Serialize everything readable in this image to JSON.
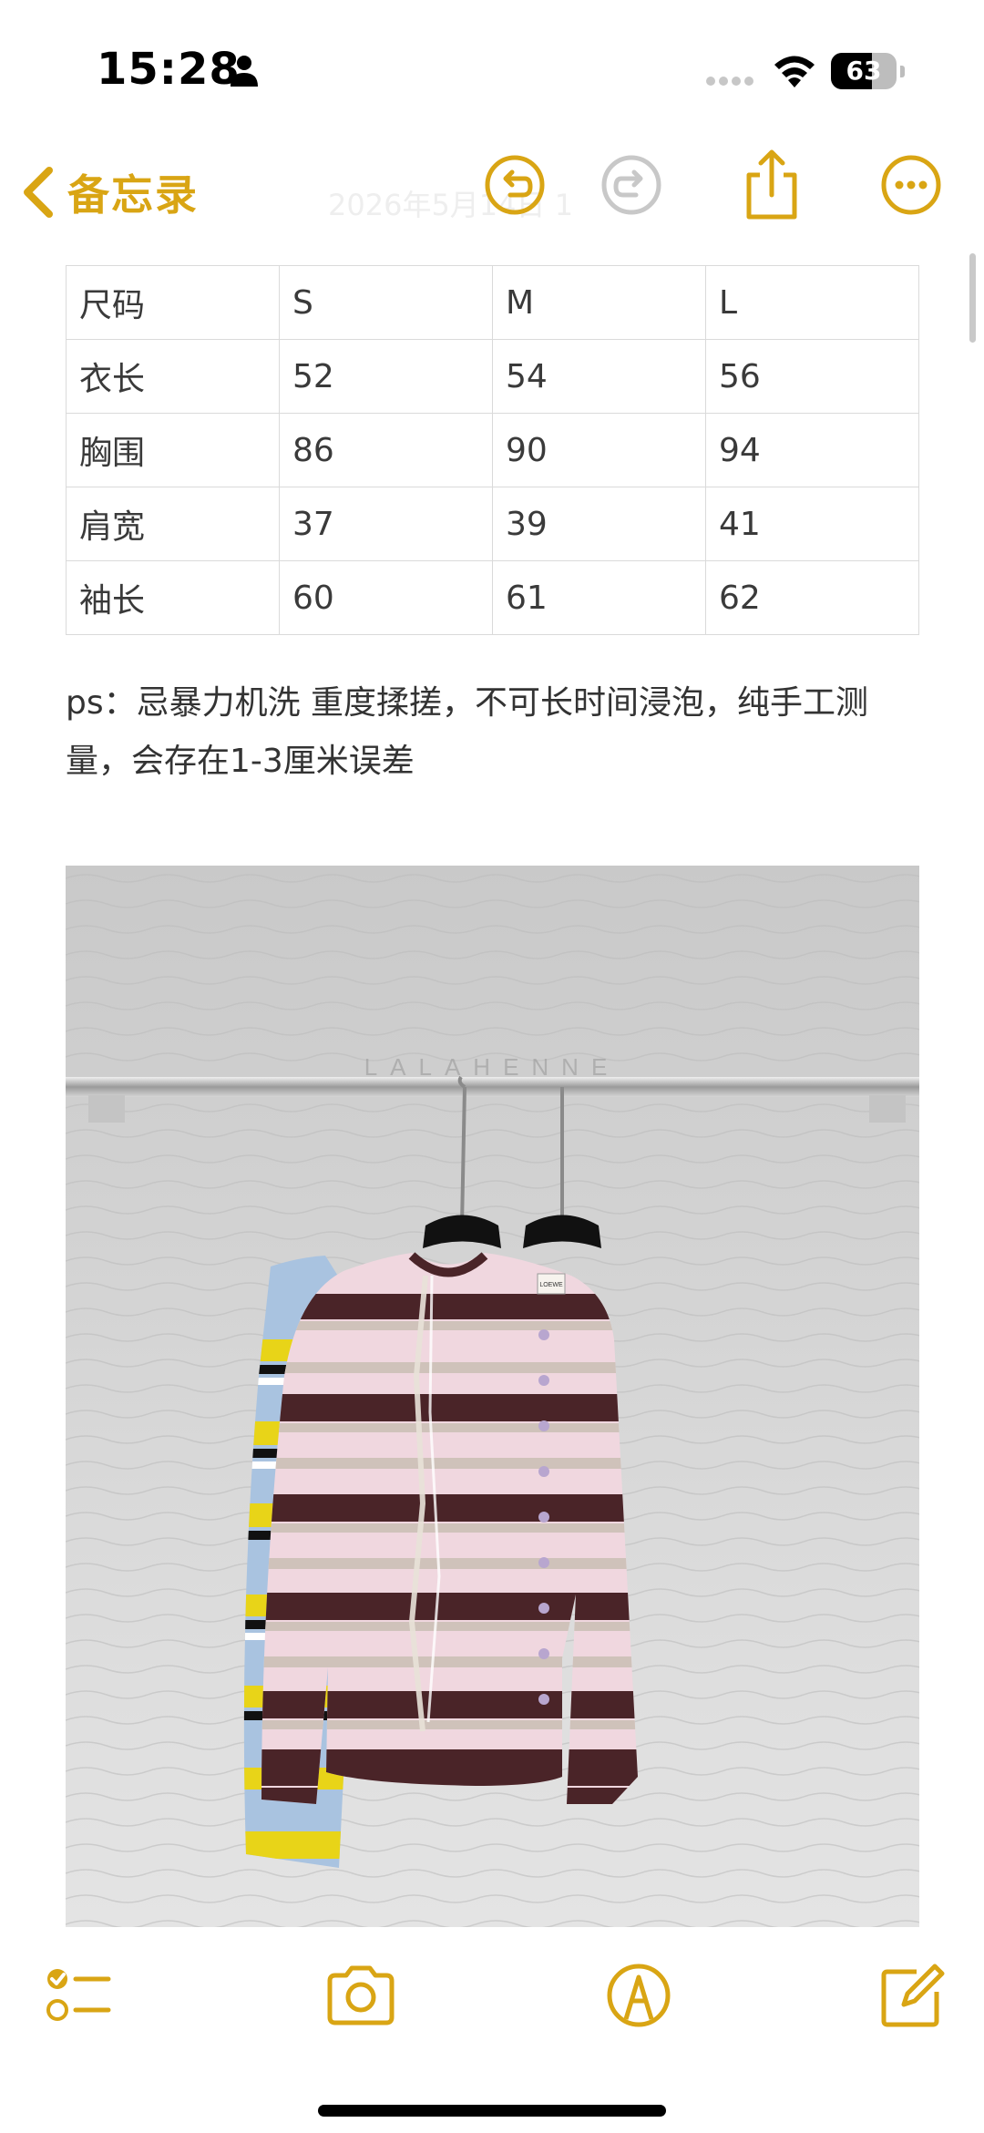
{
  "status": {
    "time": "15:28",
    "battery": "63",
    "battery_level": 0.63
  },
  "nav": {
    "back_label": "备忘录",
    "date_faint": "2026年5月14日 1",
    "accent_color": "#d9a514"
  },
  "size_table": {
    "header": [
      "尺码",
      "S",
      "M",
      "L"
    ],
    "rows": [
      [
        "衣长",
        "52",
        "54",
        "56"
      ],
      [
        "胸围",
        "86",
        "90",
        "94"
      ],
      [
        "肩宽",
        "37",
        "39",
        "41"
      ],
      [
        "袖长",
        "60",
        "61",
        "62"
      ]
    ]
  },
  "note": "ps：忌暴力机洗 重度揉搓，不可长时间浸泡，纯手工测量，会存在1-3厘米误差",
  "photo": {
    "watermark": "LALAHENNE",
    "label_tag": "LOEWE"
  },
  "toolbar": {
    "icons": [
      "checklist-icon",
      "camera-icon",
      "markup-icon",
      "compose-icon"
    ]
  }
}
